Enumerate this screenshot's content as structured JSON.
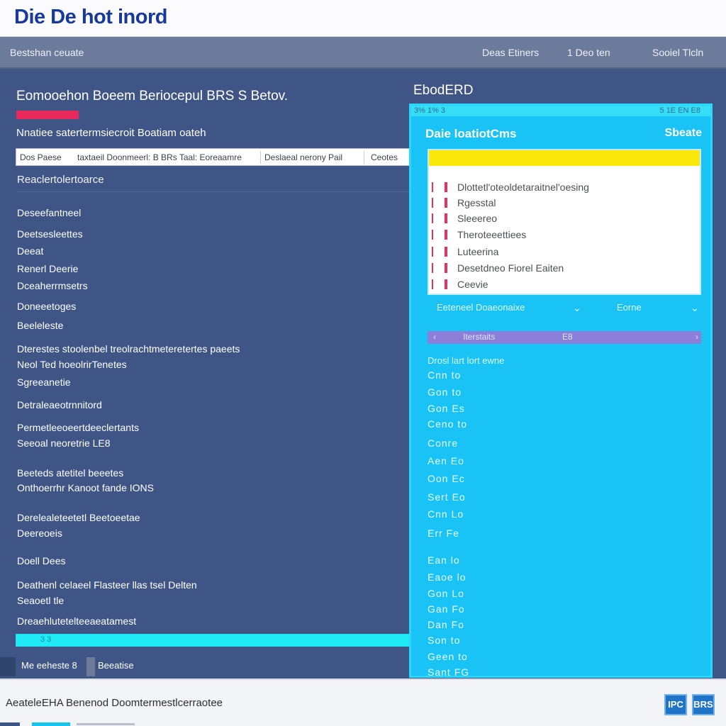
{
  "app": {
    "title": "Die De hot inord"
  },
  "nav": {
    "breadcrumb": "Bestshan ceuate",
    "links": [
      "Deas Etiners",
      "1 Deo ten",
      "Sooiel Tlcln"
    ]
  },
  "main": {
    "title": "Eomooehon Boeem Beriocepul BRS S Betov.",
    "tag": "",
    "subtitle": "Nnatiee satertermsiecroit Boatiam oateh",
    "filters": [
      "Dos Paese",
      "taxtaeil Doonmeerl: B BRs Taal: Eoreaamre",
      "Deslaeal nerony Pail",
      "Ceotes"
    ],
    "section_title": "Reaclertolertoarce",
    "items": [
      "Deseefantneel",
      "Deetsesleettes",
      "Deeat",
      "Renerl Deerie",
      "Dceaherrmsetrs",
      "Doneeetoges",
      "Beeleleste",
      "Dterestes stoolenbel treolrachtmeteretertes paeets",
      "Neol Ted hoeolrirTenetes",
      "Sgreeanetie",
      "Detraleaeotrnnitord",
      "Permetleeoeertdeeclertants",
      "Seeoal neoretrie LE8",
      "Beeteds atetitel beeetes",
      "Onthoerrhr Kanoot fande IONS",
      "Derelealeteetetl Beetoeetae",
      "Deereoeis",
      "Doell Dees",
      "Deathenl celaeel Flasteer llas tsel Delten",
      "Seaoetl tle",
      "Dreaehlutetelteeaeatamest"
    ],
    "progress_label": "3 3",
    "progress": 1.0,
    "bottom_tabs": [
      "Me eeheste 8",
      "Beeatise"
    ]
  },
  "panel": {
    "outer_title": "EbodERD",
    "strip_left": "3% 1% 3",
    "strip_right": "5 1E EN E8",
    "header_left": "Daie loatiotCms",
    "header_right": "Sbeate",
    "rows": [
      "Dlottetl'oteoldetaraitnel'oesing",
      "Rgesstal",
      "Sleeereo",
      "Theroteeettiees",
      "Luteerina",
      "Desetdneo Fiorel Eaiten",
      "Ceevie"
    ],
    "select_left": "Eeteneel Doaeonaixe",
    "select_right": "Eorne",
    "pager": {
      "left": "‹",
      "label": "Iterstaits",
      "num": "E8",
      "right": "›"
    },
    "caption": "Drosl lart lort ewne",
    "codes": [
      "Cnn to",
      "Gon to",
      "Gon Es",
      "Ceno to",
      "Conre",
      "Aen Eo",
      "Oon Ec",
      "Sert Eo",
      "Cnn Lo",
      "Err Fe",
      "Ean lo",
      "Eaoe lo",
      "Gon Lo",
      "Gan Fo",
      "Dan Fo",
      "Son to",
      "Geen to",
      "Sant FG"
    ]
  },
  "footer": {
    "text": "AeateleEHA Benenod Doomtermestlcerraotee",
    "badges": [
      "IPC",
      "BRS"
    ]
  },
  "colors": {
    "accent": "#19c3f6",
    "brand": "#17399a",
    "background": "#3e5586",
    "highlight": "#fbe90c",
    "alert": "#e8285a"
  }
}
